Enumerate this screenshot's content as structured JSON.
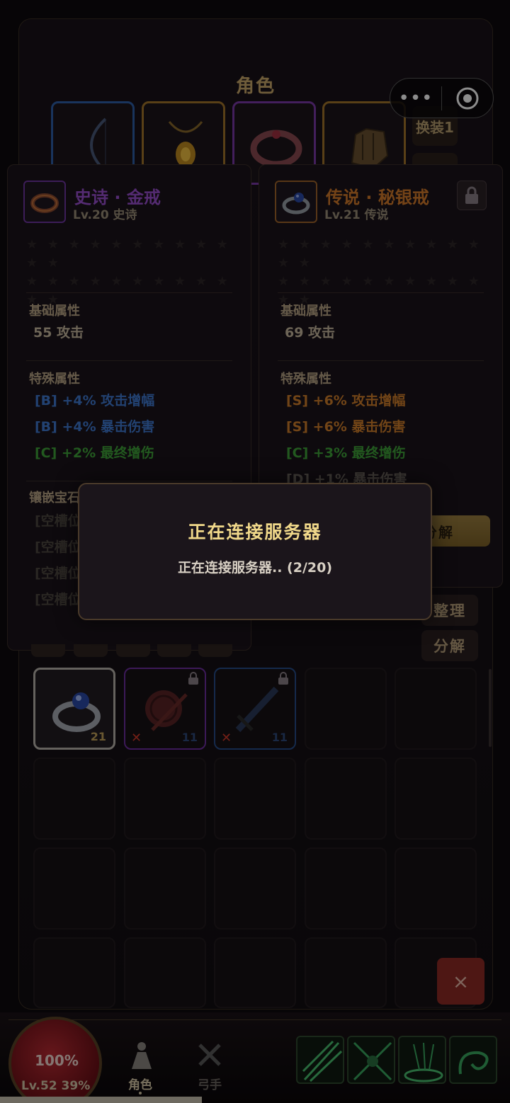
{
  "panel": {
    "title": "角色",
    "swap_label": "换装1"
  },
  "capsule": {
    "more_label": "•••"
  },
  "left_card": {
    "name": "史诗 · 金戒",
    "level": "Lv.20  史诗",
    "stars_row1": "★ ★ ★ ★ ★ ★ ★ ★ ★ ★ ★ ★",
    "stars_row2": "★ ★ ★ ★ ★ ★ ★ ★ ★ ★ ★ ★",
    "base_title": "基础属性",
    "base_value": "55 攻击",
    "special_title": "特殊属性",
    "affixes": [
      "[B] +4% 攻击增幅",
      "[B] +4% 暴击伤害",
      "[C] +2% 最终增伤"
    ],
    "socket_title": "镶嵌宝石",
    "sockets": [
      "[空槽位]",
      "[空槽位]",
      "[空槽位]",
      "[空槽位]"
    ]
  },
  "right_card": {
    "name": "传说 · 秘银戒",
    "level": "Lv.21  传说",
    "stars_row1": "★ ★ ★ ★ ★ ★ ★ ★ ★ ★ ★ ★",
    "stars_row2": "★ ★ ★ ★ ★ ★ ★ ★ ★ ★ ★ ★",
    "base_title": "基础属性",
    "base_value": "69 攻击",
    "special_title": "特殊属性",
    "affixes": [
      "[S] +6% 攻击增幅",
      "[S] +6% 暴击伤害",
      "[C] +3% 最终增伤",
      "[D] +1% 暴击伤害"
    ],
    "decompose_label": "分解"
  },
  "side_buttons": {
    "sort": "整理",
    "decompose": "分解"
  },
  "inventory": [
    {
      "level": "21",
      "icon": "silver-ring-icon"
    },
    {
      "level": "11",
      "icon": "shield-sword-icon",
      "locked": true,
      "unusable": "✕"
    },
    {
      "level": "11",
      "icon": "sword-icon",
      "locked": true,
      "unusable": "✕"
    }
  ],
  "close_label": "×",
  "hud": {
    "hp": "100%",
    "level": "Lv.52  39%",
    "nav_character": "角色",
    "nav_archer": "弓手"
  },
  "dialog": {
    "title": "正在连接服务器",
    "message": "正在连接服务器.. (2/20)"
  },
  "colors": {
    "epic": "#9a4fd0",
    "legendary": "#d37b2a",
    "accent": "#c9a86a",
    "hp": "#b82a32"
  }
}
